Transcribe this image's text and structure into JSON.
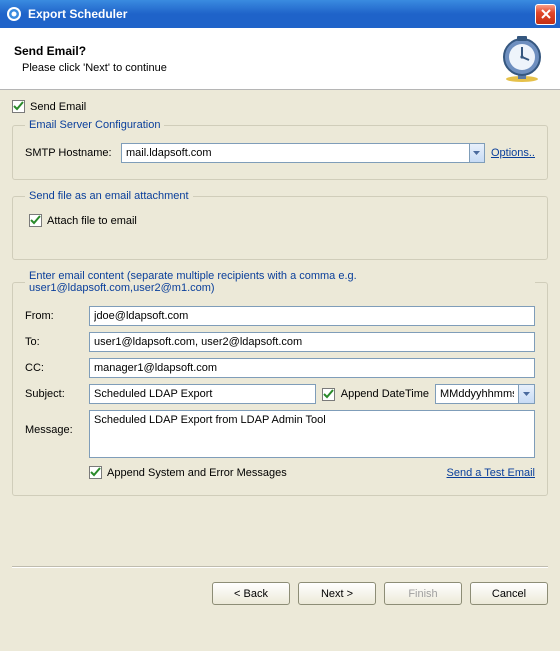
{
  "titlebar": {
    "title": "Export Scheduler"
  },
  "header": {
    "title": "Send Email?",
    "subtitle": "Please click 'Next' to continue"
  },
  "send_email": {
    "checkbox_label": "Send Email",
    "checked": true
  },
  "smtp": {
    "legend": "Email Server Configuration",
    "label": "SMTP Hostname:",
    "value": "mail.ldapsoft.com",
    "options_link": "Options.."
  },
  "attach": {
    "legend": "Send file as an email attachment",
    "checkbox_label": "Attach file to email",
    "checked": true
  },
  "content": {
    "legend": "Enter email content (separate multiple recipients with a comma e.g. user1@ldapsoft.com,user2@m1.com)",
    "from_label": "From:",
    "from_value": "jdoe@ldapsoft.com",
    "to_label": "To:",
    "to_value": "user1@ldapsoft.com, user2@ldapsoft.com",
    "cc_label": "CC:",
    "cc_value": "manager1@ldapsoft.com",
    "subject_label": "Subject:",
    "subject_value": "Scheduled LDAP Export",
    "append_dt_label": "Append DateTime",
    "append_dt_checked": true,
    "dt_format_value": "MMddyyhhmmss",
    "message_label": "Message:",
    "message_value": "Scheduled LDAP Export from LDAP Admin Tool",
    "append_sys_label": "Append System and Error Messages",
    "append_sys_checked": true,
    "test_link": "Send a Test Email"
  },
  "footer": {
    "back": "< Back",
    "next": "Next >",
    "finish": "Finish",
    "cancel": "Cancel"
  },
  "colors": {
    "link": "#0a3f9b",
    "chk_green": "#2a8a2a"
  }
}
